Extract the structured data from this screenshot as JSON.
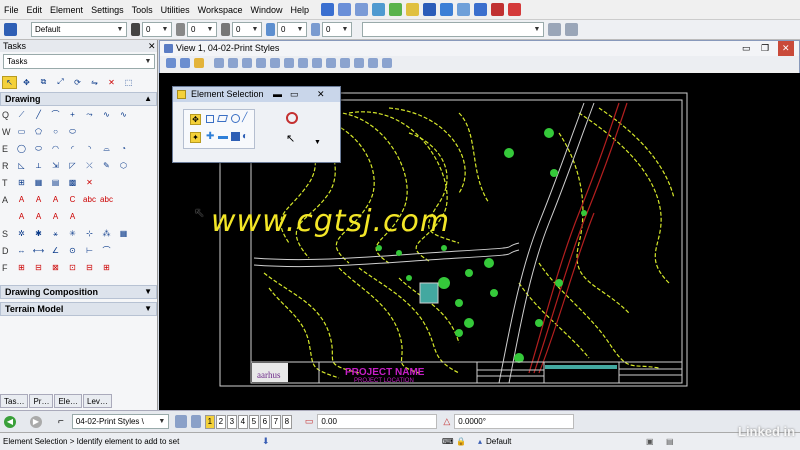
{
  "menu": [
    "File",
    "Edit",
    "Element",
    "Settings",
    "Tools",
    "Utilities",
    "Workspace",
    "Window",
    "Help"
  ],
  "attributes": {
    "level": "Default",
    "color": "0",
    "weight": "0",
    "style": "0",
    "transparency": "0",
    "priority": "0"
  },
  "tasks": {
    "header": "Tasks",
    "dropdown": "Tasks",
    "sections": {
      "drawing": "Drawing",
      "drawing_composition": "Drawing Composition",
      "terrain_model": "Terrain Model"
    },
    "row_letters": [
      "Q",
      "W",
      "E",
      "R",
      "T",
      "A",
      "S",
      "D",
      "F"
    ],
    "bottom_tabs": [
      "Tas…",
      "Pr…",
      "Ele…",
      "Lev…"
    ]
  },
  "view": {
    "title": "View 1, 04-02-Print Styles"
  },
  "dialog": {
    "title": "Element Selection"
  },
  "drawing": {
    "project_name": "PROJECT NAME",
    "project_location": "PROJECT LOCATION",
    "logo_text": "aarhus",
    "watermark": "www.cgtsj.com"
  },
  "bottom": {
    "model": "04-02-Print Styles \\",
    "view_numbers": [
      "1",
      "2",
      "3",
      "4",
      "5",
      "6",
      "7",
      "8"
    ],
    "distance": "0.00",
    "angle": "0.0000°"
  },
  "status": {
    "prompt": "Element Selection > Identify element to add to set",
    "level": "Default"
  },
  "brand": {
    "linkedin": "Linked in"
  },
  "colors": {
    "contour": "#d6e82a",
    "plan_line": "#35c93a",
    "road": "#cfcfcf",
    "red_lines": "#b31f1f",
    "title_text": "#c61fc6",
    "watermark": "#f3e627"
  }
}
